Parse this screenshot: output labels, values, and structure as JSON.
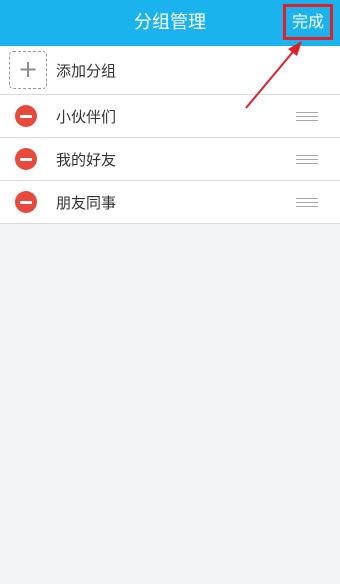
{
  "header": {
    "title": "分组管理",
    "done_label": "完成"
  },
  "add_group": {
    "icon": "plus-icon",
    "label": "添加分组"
  },
  "groups": [
    {
      "name": "小伙伴们",
      "remove_icon": "minus-circle-icon",
      "drag_icon": "drag-handle-icon"
    },
    {
      "name": "我的好友",
      "remove_icon": "minus-circle-icon",
      "drag_icon": "drag-handle-icon"
    },
    {
      "name": "朋友同事",
      "remove_icon": "minus-circle-icon",
      "drag_icon": "drag-handle-icon"
    }
  ],
  "colors": {
    "header_bg": "#1ab3ee",
    "highlight": "#e0202a",
    "remove": "#e74a3c",
    "page_bg": "#f3f4f6"
  }
}
